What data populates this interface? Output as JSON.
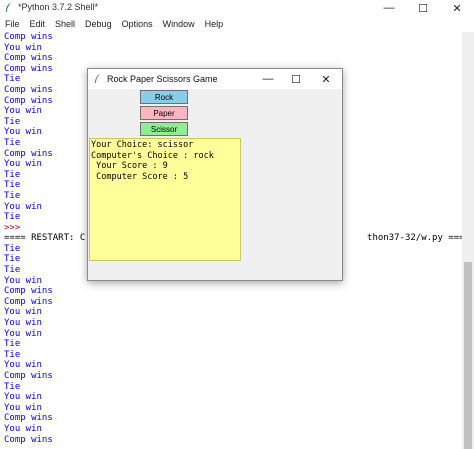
{
  "shell": {
    "title": "*Python 3.7.2 Shell*",
    "controls": {
      "minimize": "—",
      "maximize": "☐",
      "close": "✕"
    },
    "menu": [
      "File",
      "Edit",
      "Shell",
      "Debug",
      "Options",
      "Window",
      "Help"
    ],
    "lines": [
      {
        "text": "Comp wins",
        "kind": "output"
      },
      {
        "text": "You win",
        "kind": "output"
      },
      {
        "text": "Comp wins",
        "kind": "output"
      },
      {
        "text": "Comp wins",
        "kind": "output"
      },
      {
        "text": "Tie",
        "kind": "output"
      },
      {
        "text": "Comp wins",
        "kind": "output"
      },
      {
        "text": "Comp wins",
        "kind": "output"
      },
      {
        "text": "You win",
        "kind": "output"
      },
      {
        "text": "Tie",
        "kind": "output"
      },
      {
        "text": "You win",
        "kind": "output"
      },
      {
        "text": "Tie",
        "kind": "output"
      },
      {
        "text": "Comp wins",
        "kind": "output"
      },
      {
        "text": "You win",
        "kind": "output"
      },
      {
        "text": "Tie",
        "kind": "output"
      },
      {
        "text": "Tie",
        "kind": "output"
      },
      {
        "text": "Tie",
        "kind": "output"
      },
      {
        "text": "You win",
        "kind": "output"
      },
      {
        "text": "Tie",
        "kind": "output"
      },
      {
        "text": ">>>",
        "kind": "prompt"
      },
      {
        "text": "==== RESTART: C                                                    thon37-32/w.py ====",
        "kind": "restart"
      },
      {
        "text": "Tie",
        "kind": "output"
      },
      {
        "text": "Tie",
        "kind": "output"
      },
      {
        "text": "Tie",
        "kind": "output"
      },
      {
        "text": "You win",
        "kind": "output"
      },
      {
        "text": "Comp wins",
        "kind": "output"
      },
      {
        "text": "Comp wins",
        "kind": "output"
      },
      {
        "text": "You win",
        "kind": "output"
      },
      {
        "text": "You win",
        "kind": "output"
      },
      {
        "text": "You win",
        "kind": "output"
      },
      {
        "text": "Tie",
        "kind": "output"
      },
      {
        "text": "Tie",
        "kind": "output"
      },
      {
        "text": "You win",
        "kind": "output"
      },
      {
        "text": "Comp wins",
        "kind": "output"
      },
      {
        "text": "Tie",
        "kind": "output"
      },
      {
        "text": "You win",
        "kind": "output"
      },
      {
        "text": "You win",
        "kind": "output"
      },
      {
        "text": "Comp wins",
        "kind": "output"
      },
      {
        "text": "You win",
        "kind": "output"
      },
      {
        "text": "Comp wins",
        "kind": "output"
      }
    ]
  },
  "game": {
    "title": "Rock Paper Scissors Game",
    "controls": {
      "minimize": "—",
      "maximize": "☐",
      "close": "✕"
    },
    "buttons": {
      "rock": "Rock",
      "paper": "Paper",
      "scissor": "Scissor"
    },
    "result": {
      "your_choice": "Your Choice: scissor",
      "computer_choice": "Computer's Choice : rock",
      "your_score": " Your Score : 9",
      "computer_score": " Computer Score : 5"
    }
  },
  "colors": {
    "output_text": "#0000ff",
    "prompt_text": "#c00000",
    "rock_button": "#87ceeb",
    "paper_button": "#ffb6c1",
    "scissor_button": "#90ee90",
    "result_background": "#ffff99"
  }
}
